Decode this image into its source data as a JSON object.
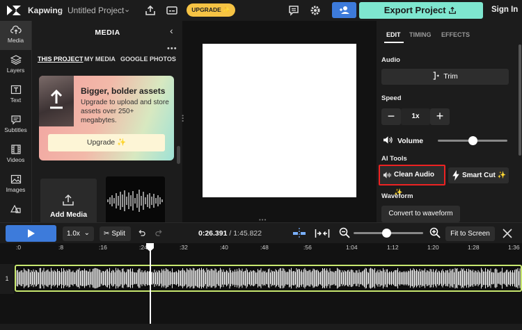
{
  "topbar": {
    "brand": "Kapwing",
    "project_title": "Untitled Project",
    "upgrade_label": "UPGRADE ✨",
    "export_label": "Export Project",
    "signin_label": "Sign In"
  },
  "rail": {
    "items": [
      {
        "label": "Media",
        "icon": "cloud-upload-icon",
        "active": true
      },
      {
        "label": "Layers",
        "icon": "layers-icon"
      },
      {
        "label": "Text",
        "icon": "text-icon"
      },
      {
        "label": "Subtitles",
        "icon": "subtitles-icon"
      },
      {
        "label": "Videos",
        "icon": "film-icon"
      },
      {
        "label": "Images",
        "icon": "image-icon"
      },
      {
        "label": "",
        "icon": "shapes-icon"
      }
    ]
  },
  "media_panel": {
    "title": "MEDIA",
    "tabs": [
      "THIS PROJECT",
      "MY MEDIA",
      "GOOGLE PHOTOS"
    ],
    "promo_title": "Bigger, bolder assets",
    "promo_body": "Upgrade to upload and store assets over 250+ megabytes.",
    "promo_button": "Upgrade ✨",
    "add_media_label": "Add Media"
  },
  "right_panel": {
    "tabs": [
      "EDIT",
      "TIMING",
      "EFFECTS"
    ],
    "audio_label": "Audio",
    "trim_label": "Trim",
    "speed_label": "Speed",
    "speed_minus": "−",
    "speed_value": "1x",
    "speed_plus": "+",
    "volume_label": "Volume",
    "volume_level": 0.5,
    "ai_tools_label": "AI Tools",
    "clean_audio_label": "Clean Audio ✨",
    "smart_cut_label": "Smart Cut ✨",
    "waveform_label": "Waveform",
    "convert_waveform_label": "Convert to waveform"
  },
  "timeline": {
    "speed_value": "1.0x",
    "split_label": "Split",
    "current_time": "0:26.391",
    "total_time": "1:45.822",
    "fit_label": "Fit to Screen",
    "track_number": "1",
    "ruler_ticks": [
      ":0",
      ":8",
      ":16",
      ":24",
      ":32",
      ":40",
      ":48",
      ":56",
      "1:04",
      "1:12",
      "1:20",
      "1:28",
      "1:36"
    ]
  },
  "colors": {
    "accent_blue": "#3d7bdb",
    "export_teal": "#7ee6cf",
    "upgrade_yellow": "#f6c344",
    "clip_border": "#c8e870",
    "highlight_red": "#e22"
  }
}
